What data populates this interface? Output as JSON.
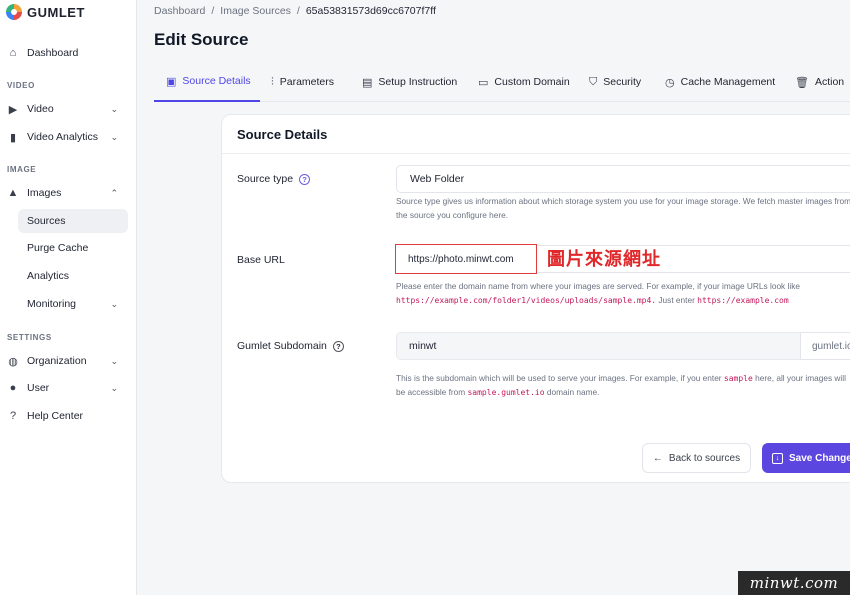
{
  "app": {
    "brand": "GUMLET"
  },
  "sidebar": {
    "dashboard": "Dashboard",
    "section_video": "VIDEO",
    "video": "Video",
    "video_analytics": "Video Analytics",
    "section_image": "IMAGE",
    "images": "Images",
    "sources": "Sources",
    "purge_cache": "Purge Cache",
    "analytics": "Analytics",
    "monitoring": "Monitoring",
    "section_settings": "SETTINGS",
    "organization": "Organization",
    "user": "User",
    "help_center": "Help Center"
  },
  "breadcrumb": {
    "item1": "Dashboard",
    "item2": "Image Sources",
    "current": "65a53831573d69cc6707f7ff",
    "sep": "/"
  },
  "page": {
    "title": "Edit Source"
  },
  "tabs": [
    {
      "label": "Source Details",
      "active": true
    },
    {
      "label": "Parameters"
    },
    {
      "label": "Setup Instruction"
    },
    {
      "label": "Custom Domain"
    },
    {
      "label": "Security"
    },
    {
      "label": "Cache Management"
    },
    {
      "label": "Action"
    }
  ],
  "card": {
    "title": "Source Details",
    "source_type": {
      "label": "Source type",
      "value": "Web Folder",
      "hint": "Source type gives us information about which storage system you use for your image storage. We fetch master images from the source you configure here."
    },
    "base_url": {
      "label": "Base URL",
      "value": "https://photo.minwt.com",
      "hint_text": "Please enter the domain name from where your images are served. For example, if your image URLs look like",
      "hint_code1": "https://example.com/folder1/videos/uploads/sample.mp4.",
      "hint_mid": "Just enter",
      "hint_code2": "https://example.com"
    },
    "subdomain": {
      "label": "Gumlet Subdomain",
      "value": "minwt",
      "suffix": "gumlet.io",
      "hint_a": "This is the subdomain which will be used to serve your images. For example, if you enter",
      "hint_code1": "sample",
      "hint_b": "here, all your images will be accessible from",
      "hint_code2": "sample.gumlet.io",
      "hint_c": "domain name."
    },
    "back_button": "Back to sources",
    "save_button": "Save Changes"
  },
  "annotation": "圖片來源網址",
  "watermark": "minwt.com",
  "colors": {
    "accent": "#5b47e0",
    "annotation_red": "#e0282a"
  }
}
